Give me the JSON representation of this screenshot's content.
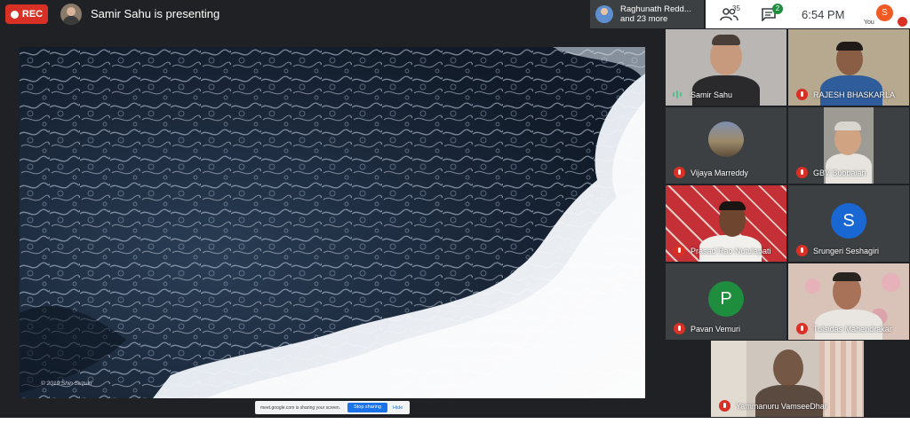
{
  "topbar": {
    "rec_label": "REC",
    "presenting_text": "Samir Sahu is presenting"
  },
  "raise": {
    "line1": "Raghunath Redd...",
    "line2": "and 23 more"
  },
  "right": {
    "people_count": "35",
    "chat_badge": "2",
    "time": "6:54  PM",
    "you_initial": "S",
    "you_label": "You"
  },
  "share": {
    "watermark": "© 2019 Shin Suzuki",
    "notice": "meet.google.com is sharing your screen.",
    "stop_label": "Stop sharing",
    "hide_label": "Hide"
  },
  "participants": [
    {
      "name": "Samir Sahu",
      "muted": false
    },
    {
      "name": "RAJESH BHASKARLA",
      "muted": true
    },
    {
      "name": "Vijaya Marreddy",
      "muted": true
    },
    {
      "name": "GBV Subbaiah",
      "muted": true
    },
    {
      "name": "Prasad Rao Nutulapati",
      "muted": true
    },
    {
      "name": "Srungeri Seshagiri",
      "muted": true,
      "initial": "S",
      "color": "#1967d2"
    },
    {
      "name": "Pavan Vemuri",
      "muted": true,
      "initial": "P",
      "color": "#1e8e3e"
    },
    {
      "name": "Tulsidas Mahendrakar",
      "muted": true
    },
    {
      "name": "Yammanuru VamseeDhar",
      "muted": true
    }
  ],
  "colors": {
    "rec": "#d93025",
    "background": "#202124",
    "tile": "#3c4043",
    "accent_blue": "#1a73e8"
  }
}
